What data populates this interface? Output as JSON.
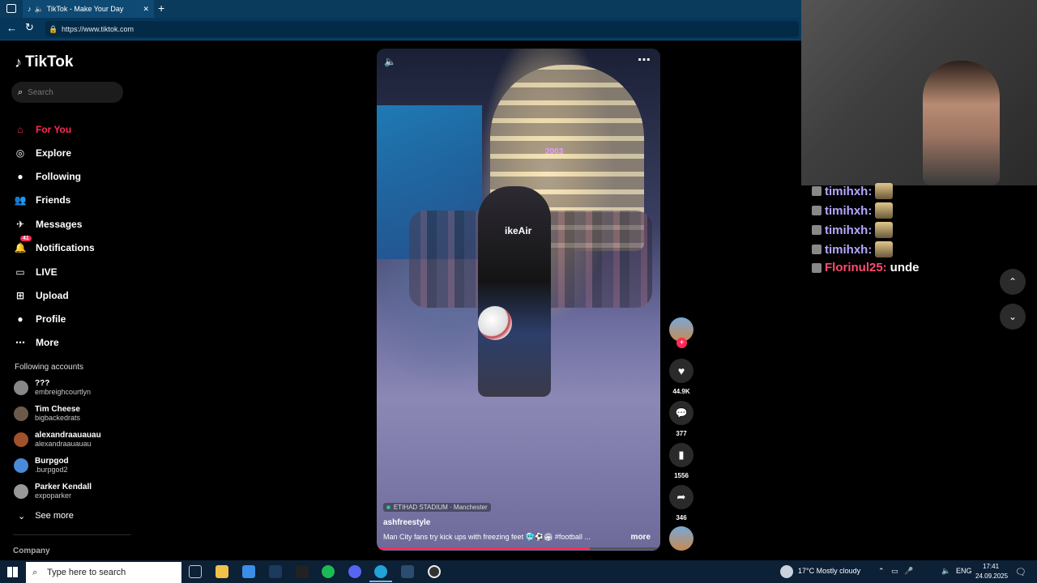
{
  "browser": {
    "tab_title": "TikTok - Make Your Day",
    "url": "https://www.tiktok.com"
  },
  "sidebar": {
    "logo": "TikTok",
    "search_placeholder": "Search",
    "nav": [
      {
        "label": "For You",
        "icon": "home-icon",
        "active": true
      },
      {
        "label": "Explore",
        "icon": "compass-icon"
      },
      {
        "label": "Following",
        "icon": "following-avatar"
      },
      {
        "label": "Friends",
        "icon": "friends-icon"
      },
      {
        "label": "Messages",
        "icon": "messages-icon"
      },
      {
        "label": "Notifications",
        "icon": "notifications-icon",
        "badge": "41"
      },
      {
        "label": "LIVE",
        "icon": "live-icon"
      },
      {
        "label": "Upload",
        "icon": "upload-icon"
      },
      {
        "label": "Profile",
        "icon": "profile-avatar"
      },
      {
        "label": "More",
        "icon": "more-icon"
      }
    ],
    "following_title": "Following accounts",
    "accounts": [
      {
        "name": "???",
        "user": "embreighcourtlyn"
      },
      {
        "name": "Tim Cheese",
        "user": "bigbackedrats"
      },
      {
        "name": "alexandraauauau",
        "user": "alexandraauauau"
      },
      {
        "name": "Burpgod",
        "user": ".burpgod2"
      },
      {
        "name": "Parker Kendall",
        "user": "expoparker"
      }
    ],
    "see_more": "See more",
    "company": "Company"
  },
  "video": {
    "location": "ETIHAD STADIUM · Manchester",
    "author": "ashfreestyle",
    "caption": "Man City fans try kick ups with freezing feet 🥶⚽️🏟 #football ...",
    "more": "more",
    "jersey_text": "ikeAir",
    "stand_year": "2003"
  },
  "actions": {
    "likes": "44.9K",
    "comments": "377",
    "saves": "1556",
    "shares": "346"
  },
  "chat": [
    {
      "user": "timihxh:",
      "msg": "",
      "color": "#b6a6ff"
    },
    {
      "user": "timihxh:",
      "msg": "",
      "color": "#b6a6ff"
    },
    {
      "user": "timihxh:",
      "msg": "",
      "color": "#b6a6ff"
    },
    {
      "user": "timihxh:",
      "msg": "",
      "color": "#b6a6ff"
    },
    {
      "user": "Florinul25:",
      "msg": "unde",
      "color": "#ff4d6d"
    }
  ],
  "taskbar": {
    "search_placeholder": "Type here to search",
    "weather": "17°C  Mostly cloudy",
    "lang": "ENG",
    "time": "17:41",
    "date": "24.09.2025"
  },
  "colors": {
    "accent": "#fe2c55",
    "taskbar": "#0c2036",
    "browser": "#06375a"
  }
}
